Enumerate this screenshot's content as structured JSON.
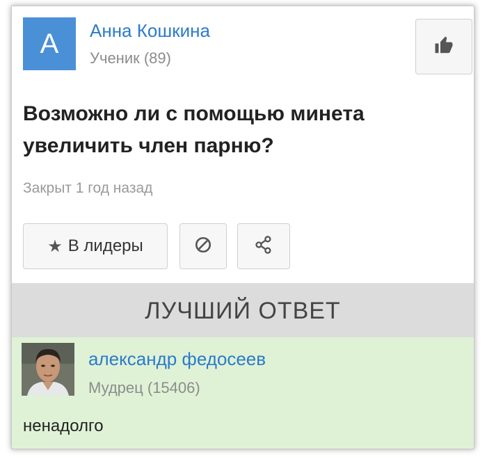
{
  "question": {
    "author": {
      "avatar_letter": "A",
      "name": "Анна Кошкина",
      "rank": "Ученик (89)"
    },
    "title": "Возможно ли с помощью минета увеличить член парню?",
    "status": "Закрыт 1 год назад",
    "actions": {
      "leaders_label": "В лидеры"
    }
  },
  "best_answer": {
    "header": "ЛУЧШИЙ ОТВЕТ",
    "author": {
      "name": "александр федосеев",
      "rank": "Мудрец (15406)"
    },
    "text": "ненадолго"
  },
  "icons": {
    "like": "thumbs-up-icon",
    "leaders": "star-icon",
    "report": "block-icon",
    "share": "share-icon"
  },
  "colors": {
    "accent": "#2b7bc9",
    "avatar_bg": "#4a90d6",
    "best_header_bg": "#dcdcdc",
    "answer_bg": "#dff2d6"
  }
}
